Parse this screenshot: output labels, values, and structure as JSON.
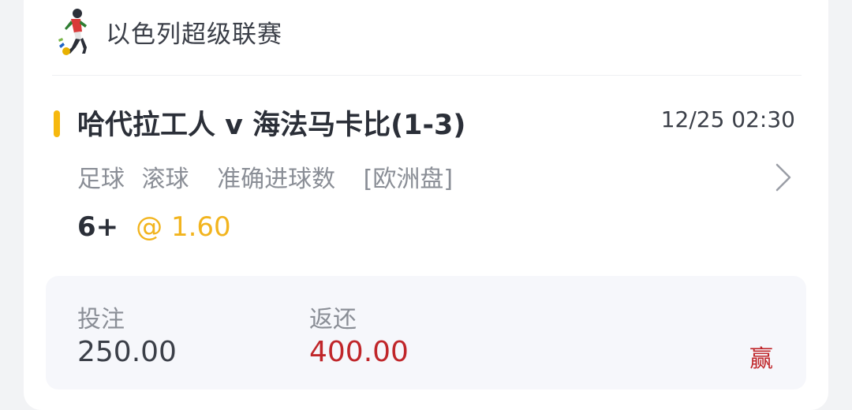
{
  "league": {
    "icon": "soccer-player-icon",
    "name": "以色列超级联赛"
  },
  "match": {
    "title": "哈代拉工人 v 海法马卡比(1-3)",
    "time": "12/25 02:30",
    "sport": "足球",
    "mode": "滚球",
    "market": "准确进球数",
    "odds_type": "[欧洲盘]",
    "selection": "6+",
    "odds": "@ 1.60"
  },
  "summary": {
    "stake_label": "投注",
    "stake_value": "250.00",
    "return_label": "返还",
    "return_value": "400.00",
    "result": "赢"
  },
  "colors": {
    "accent": "#f6b80e",
    "odds": "#f2b41e",
    "win": "#c0262a",
    "card_bg": "#ffffff",
    "page_bg": "#f2f3f5"
  }
}
